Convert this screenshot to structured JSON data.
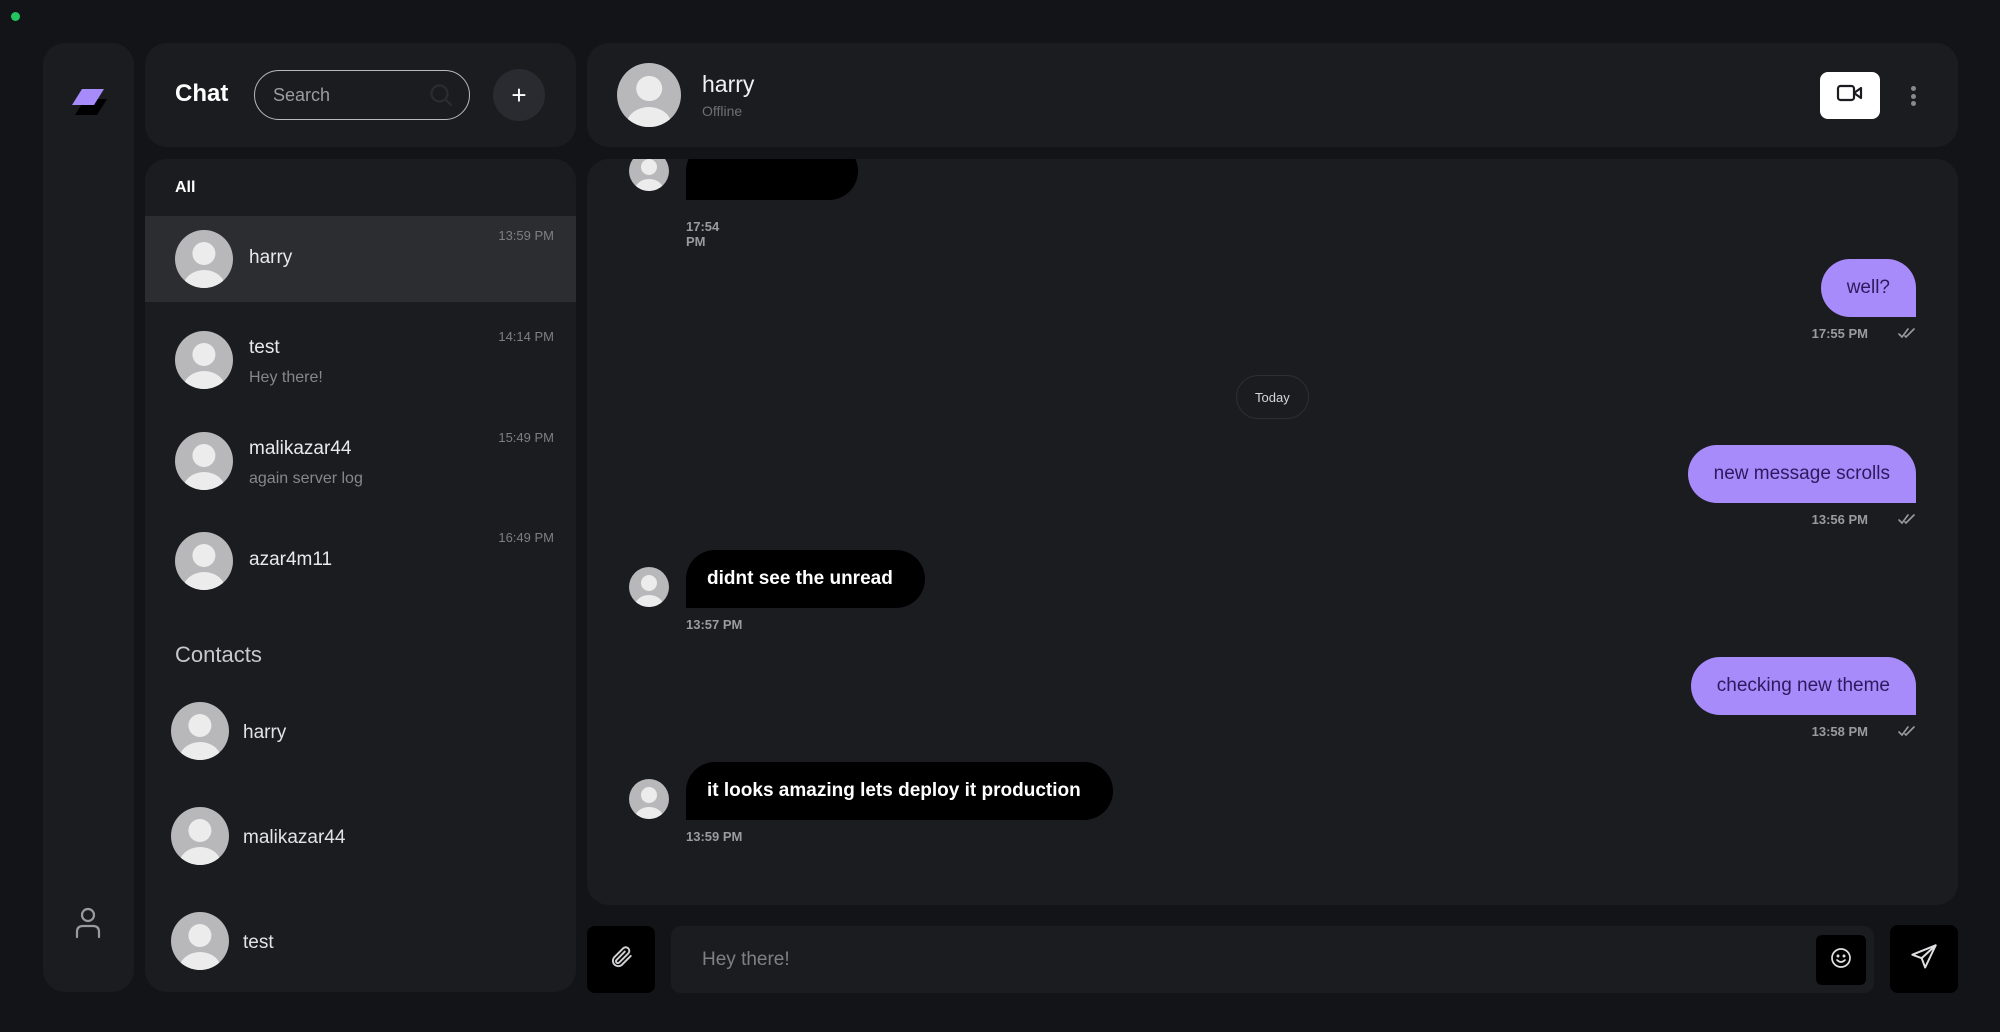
{
  "colors": {
    "accent": "#a78bfa",
    "background": "#131417",
    "panel": "#1b1c20",
    "online_dot": "#22c55e"
  },
  "rail": {
    "logo_icon": "layers-logo-icon",
    "user_icon": "user-icon"
  },
  "list_header": {
    "title": "Chat",
    "search_placeholder": "Search",
    "search_icon": "search-icon",
    "add_label": "+"
  },
  "conversations": {
    "filter_label": "All",
    "items": [
      {
        "name": "harry",
        "preview": "",
        "time": "13:59 PM",
        "active": true
      },
      {
        "name": "test",
        "preview": "Hey there!",
        "time": "14:14 PM",
        "active": false
      },
      {
        "name": "malikazar44",
        "preview": "again server log",
        "time": "15:49 PM",
        "active": false
      },
      {
        "name": "azar4m11",
        "preview": "",
        "time": "16:49 PM",
        "active": false
      }
    ]
  },
  "contacts": {
    "title": "Contacts",
    "items": [
      {
        "name": "harry"
      },
      {
        "name": "malikazar44"
      },
      {
        "name": "test"
      }
    ]
  },
  "chat_header": {
    "peer_name": "harry",
    "peer_status": "Offline",
    "video_icon": "video-camera-icon",
    "more_icon": "more-vertical-icon"
  },
  "messages": {
    "day_separator": "Today",
    "items": [
      {
        "direction": "in",
        "text": "",
        "time": "17:54 PM",
        "partially_hidden": true
      },
      {
        "direction": "out",
        "text": "well?",
        "time": "17:55 PM",
        "read": true
      },
      {
        "direction": "out",
        "text": "new message scrolls",
        "time": "13:56 PM",
        "read": true
      },
      {
        "direction": "in",
        "text": "didnt see the unread",
        "time": "13:57 PM"
      },
      {
        "direction": "out",
        "text": "checking new theme",
        "time": "13:58 PM",
        "read": true
      },
      {
        "direction": "in",
        "text": "it looks amazing lets deploy it production",
        "time": "13:59 PM"
      }
    ]
  },
  "composer": {
    "placeholder": "Hey there!",
    "value": "",
    "attach_icon": "paperclip-icon",
    "emoji_icon": "smiley-icon",
    "send_icon": "send-icon"
  }
}
